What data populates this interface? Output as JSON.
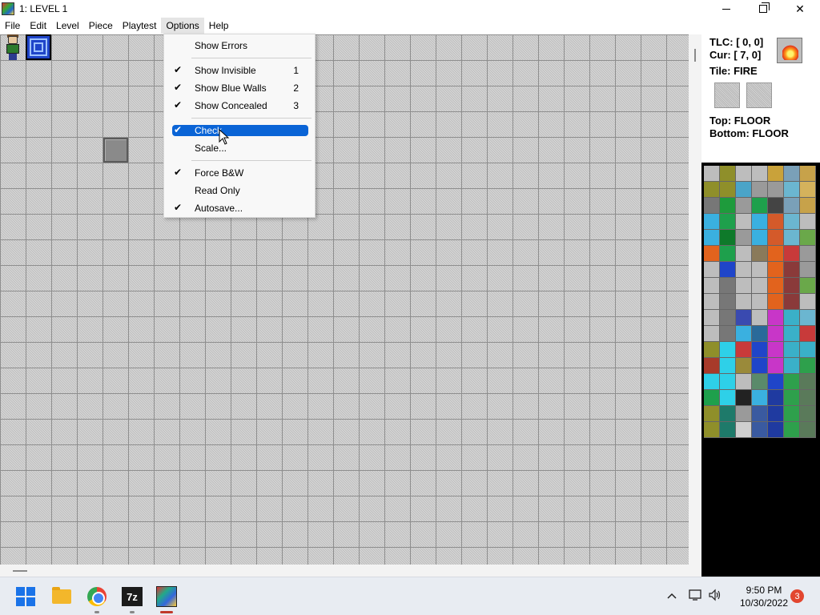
{
  "window": {
    "title": "1: LEVEL 1",
    "min_glyph": "",
    "max_glyph": "",
    "close_glyph": "✕"
  },
  "menubar": {
    "items": [
      "File",
      "Edit",
      "Level",
      "Piece",
      "Playtest",
      "Options",
      "Help"
    ],
    "active": "Options"
  },
  "options_menu": {
    "items": [
      {
        "label": "Show Errors",
        "checked": false,
        "accel": ""
      },
      {
        "label": "Show Invisible",
        "checked": true,
        "accel": "1"
      },
      {
        "label": "Show Blue Walls",
        "checked": true,
        "accel": "2"
      },
      {
        "label": "Show Concealed",
        "checked": true,
        "accel": "3"
      },
      {
        "label": "Check",
        "checked": true,
        "accel": "",
        "highlighted": true
      },
      {
        "label": "Scale...",
        "checked": false,
        "accel": ""
      },
      {
        "label": "Force B&W",
        "checked": true,
        "accel": ""
      },
      {
        "label": "Read Only",
        "checked": false,
        "accel": ""
      },
      {
        "label": "Autosave...",
        "checked": true,
        "accel": ""
      }
    ],
    "check_glyph": "✔"
  },
  "info_panel": {
    "tlc": "TLC: [ 0, 0]",
    "cur": "Cur: [ 7, 0]",
    "tile": "Tile: FIRE",
    "top": "Top: FLOOR",
    "bottom": "Bottom: FLOOR"
  },
  "palette": {
    "colors": [
      [
        "#bdbdbd",
        "#8f8f2a",
        "#bdbdbd",
        "#bdbdbd",
        "#c9a23a",
        "#7aa0b8",
        "#c7a24a"
      ],
      [
        "#8f8f2a",
        "#8f8f2a",
        "#4aa4c8",
        "#9a9a9a",
        "#9a9a9a",
        "#6bb6d0",
        "#d4b25c"
      ],
      [
        "#777777",
        "#1e9b3c",
        "#9a9a9a",
        "#1ea04c",
        "#444444",
        "#7aa0b8",
        "#c7a24a"
      ],
      [
        "#3ab0e0",
        "#1ea04c",
        "#bdbdbd",
        "#3ab0e0",
        "#d45a2a",
        "#6bb6d0",
        "#bdbdbd"
      ],
      [
        "#3ab0e0",
        "#0e7a2a",
        "#9a9a9a",
        "#3ab0e0",
        "#d45a2a",
        "#6bb6d0",
        "#6aa84a"
      ],
      [
        "#e2631d",
        "#1ea04c",
        "#bdbdbd",
        "#8a7a5a",
        "#e2631d",
        "#c83a3a",
        "#9a9a9a"
      ],
      [
        "#bdbdbd",
        "#1f45c9",
        "#bdbdbd",
        "#bdbdbd",
        "#e2631d",
        "#8a3a3a",
        "#9a9a9a"
      ],
      [
        "#bdbdbd",
        "#777777",
        "#bdbdbd",
        "#bdbdbd",
        "#e2631d",
        "#8a3a3a",
        "#6aa84a"
      ],
      [
        "#bdbdbd",
        "#777777",
        "#bdbdbd",
        "#bdbdbd",
        "#e2631d",
        "#8a3a3a",
        "#bdbdbd"
      ],
      [
        "#bdbdbd",
        "#777777",
        "#3a4ab0",
        "#bdbdbd",
        "#c836c8",
        "#3ab0c8",
        "#6bb6d0"
      ],
      [
        "#bdbdbd",
        "#777777",
        "#3ab0e0",
        "#2a6a9a",
        "#c836c8",
        "#3ab0c8",
        "#c83a3a"
      ],
      [
        "#8f8f2a",
        "#2ed0e8",
        "#c83a3a",
        "#1f45c9",
        "#c836c8",
        "#3ab0c8",
        "#3ab0c8"
      ],
      [
        "#a83a2a",
        "#2ed0e8",
        "#9a8a3a",
        "#1f45c9",
        "#c836c8",
        "#3ab0c8",
        "#2ea04c"
      ],
      [
        "#2ed0e8",
        "#2ed0e8",
        "#bdbdbd",
        "#5a8a6a",
        "#1f45c9",
        "#2ea04c",
        "#5a7a5a"
      ],
      [
        "#1ea04c",
        "#2ed0e8",
        "#222222",
        "#3ab0e0",
        "#1f3aa0",
        "#2ea04c",
        "#5a7a5a"
      ],
      [
        "#8f8f2a",
        "#1e7a6a",
        "#9a9a9a",
        "#3a5aa0",
        "#1f3aa0",
        "#2ea04c",
        "#5a7a5a"
      ],
      [
        "#8f8f2a",
        "#1e7a6a",
        "#cfcfcf",
        "#3a5aa0",
        "#1f3aa0",
        "#2ea04c",
        "#5a7a5a"
      ]
    ]
  },
  "taskbar": {
    "sevenzip_label": "7z",
    "time": "9:50 PM",
    "date": "10/30/2022",
    "notifications": "3",
    "tray_chevron": "^"
  }
}
